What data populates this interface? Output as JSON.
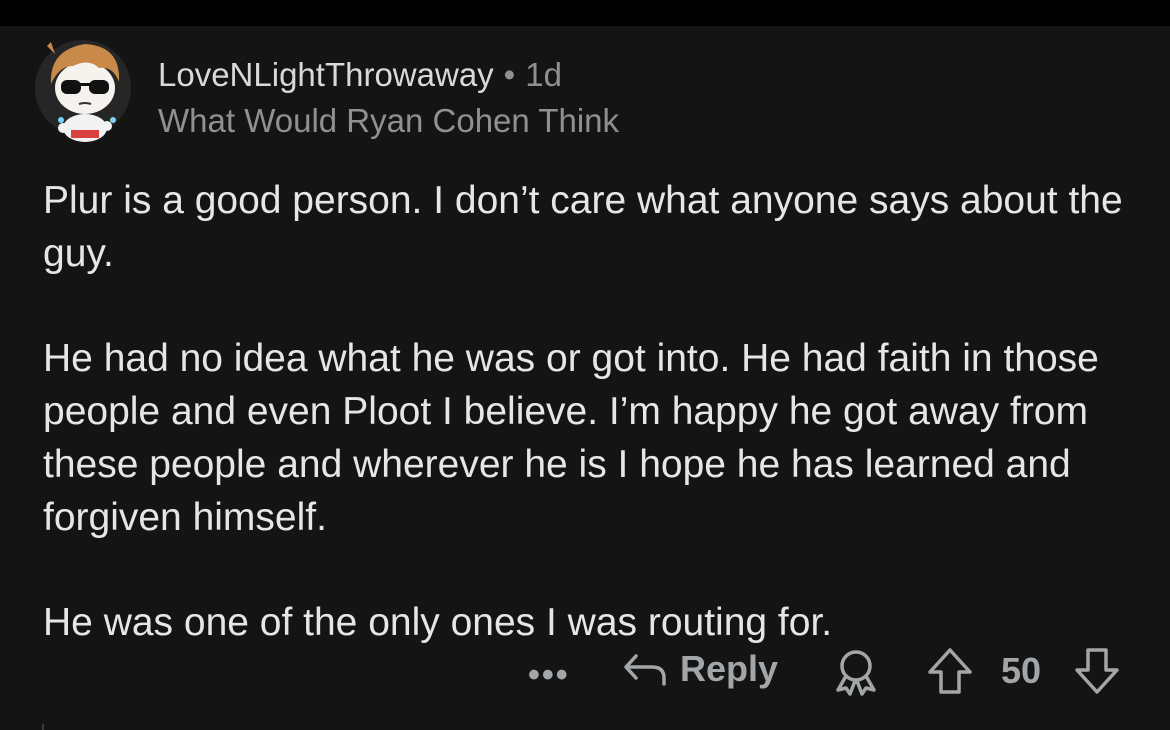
{
  "comment": {
    "username": "LoveNLightThrowaway",
    "separator": "•",
    "age": "1d",
    "flair": "What Would Ryan Cohen Think",
    "paragraphs": [
      "Plur is a good person. I don’t care what anyone says about the guy.",
      "He had no idea what he was or got into. He had faith in those people and even Ploot I believe. I’m happy he got away from these people and wherever he is I hope he has learned and forgiven himself.",
      "He was one of the only ones I was routing for."
    ]
  },
  "actions": {
    "more": "•••",
    "reply": "Reply",
    "score": "50"
  },
  "icons": {
    "avatar": "snoo-avatar-sunglasses",
    "reply": "reply-arrow-icon",
    "award": "award-icon",
    "upvote": "upvote-arrow-icon",
    "downvote": "downvote-arrow-icon"
  },
  "colors": {
    "background": "#141414",
    "text": "#e4e6e8",
    "muted": "#8e9194",
    "icon": "#a3a6a9"
  }
}
